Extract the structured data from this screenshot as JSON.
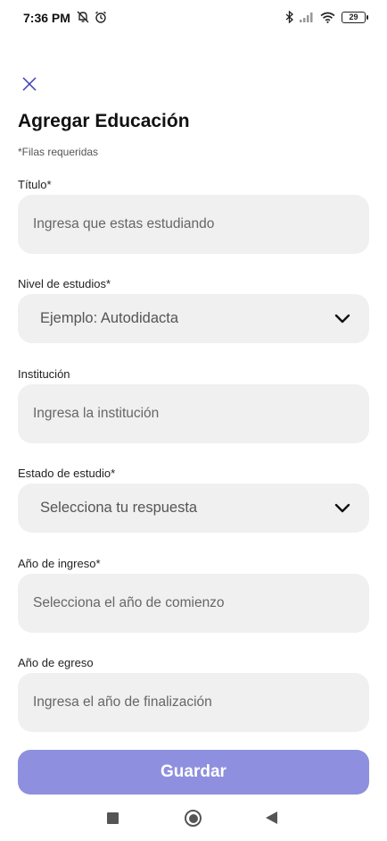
{
  "status_bar": {
    "time": "7:36 PM",
    "battery": "29"
  },
  "form": {
    "title": "Agregar Educación",
    "required_note": "*Filas requeridas",
    "fields": {
      "titulo": {
        "label": "Título*",
        "placeholder": "Ingresa que estas estudiando"
      },
      "nivel": {
        "label": "Nivel de estudios*",
        "value": "Ejemplo: Autodidacta"
      },
      "institucion": {
        "label": "Institución",
        "placeholder": "Ingresa la institución"
      },
      "estado": {
        "label": "Estado de estudio*",
        "value": "Selecciona tu respuesta"
      },
      "ingreso": {
        "label": "Año de ingreso*",
        "placeholder": "Selecciona el año de comienzo"
      },
      "egreso": {
        "label": "Año de egreso",
        "placeholder": "Ingresa el año de finalización"
      }
    },
    "save_label": "Guardar"
  },
  "colors": {
    "accent": "#8f8fdf",
    "field_bg": "#f0f0f0",
    "close_icon": "#3b3bb0"
  },
  "icons": [
    "mute-icon",
    "alarm-icon",
    "bluetooth-icon",
    "signal-icon",
    "wifi-icon",
    "battery-icon",
    "close-icon",
    "chevron-down-icon"
  ]
}
